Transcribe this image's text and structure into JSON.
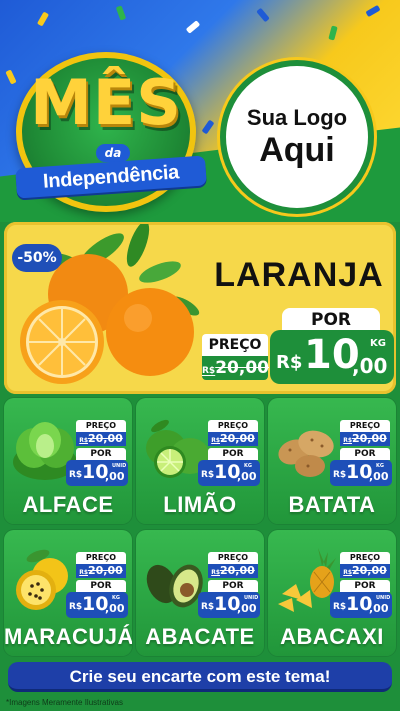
{
  "header": {
    "badge_title": "MÊS",
    "badge_da": "da",
    "badge_subtitle": "Independência",
    "logo_line1": "Sua Logo",
    "logo_line2": "Aqui"
  },
  "featured": {
    "discount": "-50%",
    "name": "LARANJA",
    "preco_label": "PREÇO",
    "old_currency": "R$",
    "old_price": "20,00",
    "por_label": "POR",
    "currency": "R$",
    "price_int": "10",
    "price_dec": ",00",
    "unit": "KG",
    "icon": "orange-icon"
  },
  "products": [
    {
      "name": "ALFACE",
      "preco_label": "PREÇO",
      "old_currency": "R$",
      "old_price": "20,00",
      "por_label": "POR",
      "currency": "R$",
      "price_int": "10",
      "price_dec": ",00",
      "unit": "UNID",
      "icon": "lettuce-icon"
    },
    {
      "name": "LIMÃO",
      "preco_label": "PREÇO",
      "old_currency": "R$",
      "old_price": "20,00",
      "por_label": "POR",
      "currency": "R$",
      "price_int": "10",
      "price_dec": ",00",
      "unit": "KG",
      "icon": "lime-icon"
    },
    {
      "name": "BATATA",
      "preco_label": "PREÇO",
      "old_currency": "R$",
      "old_price": "20,00",
      "por_label": "POR",
      "currency": "R$",
      "price_int": "10",
      "price_dec": ",00",
      "unit": "KG",
      "icon": "potato-icon"
    },
    {
      "name": "MARACUJÁ",
      "preco_label": "PREÇO",
      "old_currency": "R$",
      "old_price": "20,00",
      "por_label": "POR",
      "currency": "R$",
      "price_int": "10",
      "price_dec": ",00",
      "unit": "KG",
      "icon": "passion-fruit-icon"
    },
    {
      "name": "ABACATE",
      "preco_label": "PREÇO",
      "old_currency": "R$",
      "old_price": "20,00",
      "por_label": "POR",
      "currency": "R$",
      "price_int": "10",
      "price_dec": ",00",
      "unit": "UNID",
      "icon": "avocado-icon"
    },
    {
      "name": "ABACAXI",
      "preco_label": "PREÇO",
      "old_currency": "R$",
      "old_price": "20,00",
      "por_label": "POR",
      "currency": "R$",
      "price_int": "10",
      "price_dec": ",00",
      "unit": "UNID",
      "icon": "pineapple-icon"
    }
  ],
  "footer": {
    "cta": "Crie seu encarte com este tema!",
    "disclaimer": "*Imagens Meramente Ilustrativas"
  },
  "colors": {
    "brand_green": "#1e8f3a",
    "brand_blue": "#1f5bd6",
    "brand_yellow": "#f7c91c"
  }
}
